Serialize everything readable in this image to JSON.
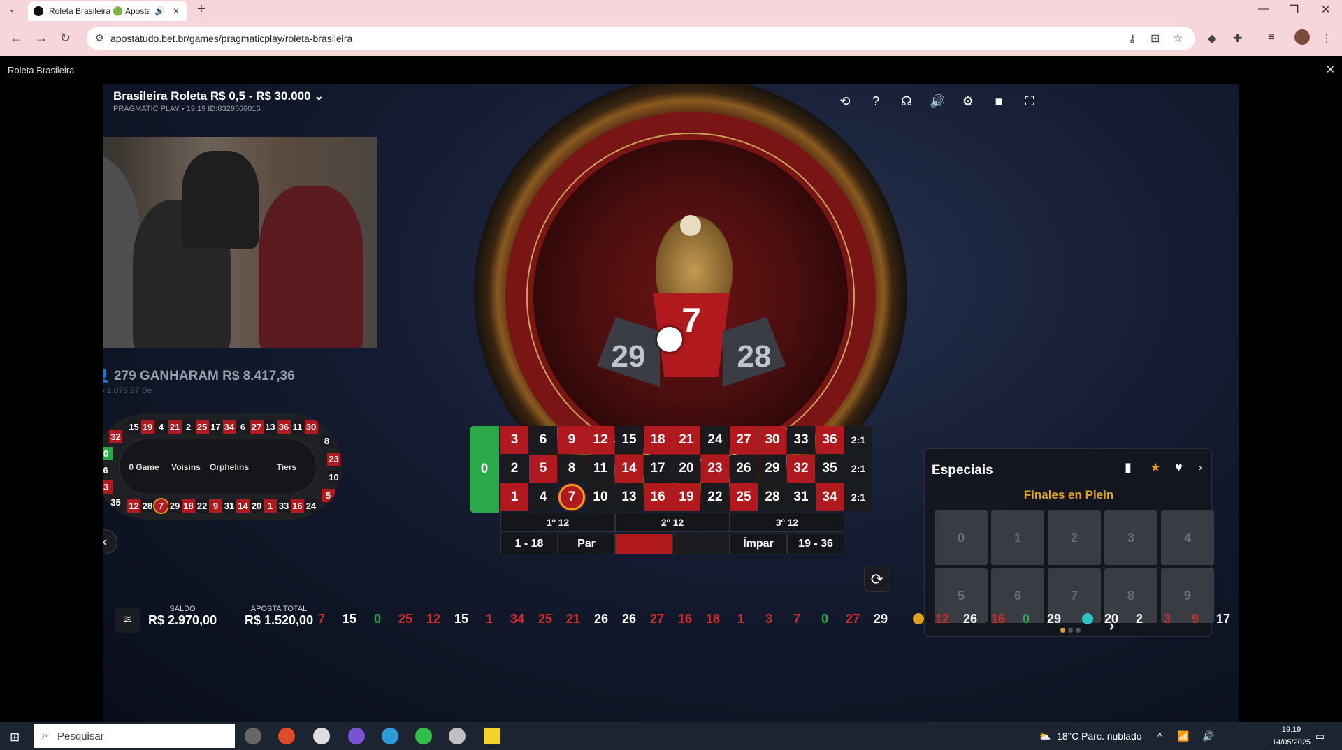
{
  "browser": {
    "tab_title": "Roleta Brasileira 🟢 Aposta",
    "tab_close": "✕",
    "new_tab": "+",
    "url": "apostatudo.bet.br/games/pragmaticplay/roleta-brasileira",
    "window_controls": [
      "—",
      "❐",
      "✕"
    ]
  },
  "frame": {
    "title": "Roleta Brasileira",
    "close": "✕"
  },
  "game": {
    "title": "Brasileira Roleta R$ 0,5 - R$ 30.000",
    "subtitle": "PRAGMATIC PLAY • 19:19 ID:8329566016",
    "result": {
      "number": "7",
      "left_neighbor": "29",
      "right_neighbor": "28"
    },
    "toolbar_icons": [
      "history-icon",
      "help-icon",
      "support-icon",
      "sound-icon",
      "settings-icon",
      "video-icon",
      "fullscreen-icon"
    ],
    "winners": "279 GANHARAM R$ 8.417,36",
    "winners_sub": "R$ 1.079,97 Be"
  },
  "racetrack": {
    "sections": [
      "0 Game",
      "Voisins",
      "Orphelins",
      "Tiers"
    ],
    "top_row": [
      "15",
      "19",
      "4",
      "21",
      "2",
      "25",
      "17",
      "34",
      "6",
      "27",
      "13",
      "36",
      "11",
      "30"
    ],
    "bottom_row": [
      "12",
      "28",
      "7",
      "29",
      "18",
      "22",
      "9",
      "31",
      "14",
      "20",
      "1",
      "33",
      "16",
      "24"
    ],
    "left_arc": [
      "32",
      "0",
      "26",
      "3",
      "35"
    ],
    "right_arc": [
      "8",
      "23",
      "10",
      "5"
    ]
  },
  "table": {
    "zero": "0",
    "rows": [
      [
        "3",
        "6",
        "9",
        "12",
        "15",
        "18",
        "21",
        "24",
        "27",
        "30",
        "33",
        "36"
      ],
      [
        "2",
        "5",
        "8",
        "11",
        "14",
        "17",
        "20",
        "23",
        "26",
        "29",
        "32",
        "35"
      ],
      [
        "1",
        "4",
        "7",
        "10",
        "13",
        "16",
        "19",
        "22",
        "25",
        "28",
        "31",
        "34"
      ]
    ],
    "row_colors": [
      [
        "red",
        "black",
        "red",
        "red",
        "black",
        "red",
        "red",
        "black",
        "red",
        "red",
        "black",
        "red"
      ],
      [
        "black",
        "red",
        "black",
        "black",
        "red",
        "black",
        "black",
        "red",
        "black",
        "black",
        "red",
        "black"
      ],
      [
        "red",
        "black",
        "red",
        "black",
        "black",
        "red",
        "red",
        "black",
        "red",
        "black",
        "black",
        "red"
      ]
    ],
    "column_bets": [
      "2:1",
      "2:1",
      "2:1"
    ],
    "dozens": [
      "1º 12",
      "2º 12",
      "3º 12"
    ],
    "even_bets": [
      "1 - 18",
      "Par",
      "",
      "",
      "Ímpar",
      "19 - 36"
    ],
    "winning_number": "7"
  },
  "specials": {
    "title": "Especiais",
    "subtitle": "Finales en Plein",
    "buttons": [
      "0",
      "1",
      "2",
      "3",
      "4",
      "5",
      "6",
      "7",
      "8",
      "9"
    ]
  },
  "footer": {
    "saldo_label": "SALDO",
    "saldo_value": "R$ 2.970,00",
    "aposta_label": "APOSTA TOTAL",
    "aposta_value": "R$ 1.520,00",
    "history": [
      {
        "n": "7",
        "c": "red"
      },
      {
        "n": "15",
        "c": "black"
      },
      {
        "n": "0",
        "c": "green"
      },
      {
        "n": "25",
        "c": "red"
      },
      {
        "n": "12",
        "c": "red"
      },
      {
        "n": "15",
        "c": "black"
      },
      {
        "n": "1",
        "c": "red"
      },
      {
        "n": "34",
        "c": "red"
      },
      {
        "n": "25",
        "c": "red"
      },
      {
        "n": "21",
        "c": "red"
      },
      {
        "n": "26",
        "c": "black"
      },
      {
        "n": "26",
        "c": "black"
      },
      {
        "n": "27",
        "c": "red"
      },
      {
        "n": "16",
        "c": "red"
      },
      {
        "n": "18",
        "c": "red"
      },
      {
        "n": "1",
        "c": "red"
      },
      {
        "n": "3",
        "c": "red"
      },
      {
        "n": "7",
        "c": "red"
      },
      {
        "n": "0",
        "c": "green"
      },
      {
        "n": "27",
        "c": "red"
      },
      {
        "n": "29",
        "c": "black"
      }
    ],
    "hot": [
      {
        "n": "12",
        "c": "red"
      },
      {
        "n": "26",
        "c": "black"
      },
      {
        "n": "16",
        "c": "red"
      },
      {
        "n": "0",
        "c": "green"
      },
      {
        "n": "29",
        "c": "black"
      }
    ],
    "cold": [
      {
        "n": "20",
        "c": "black"
      },
      {
        "n": "2",
        "c": "black"
      },
      {
        "n": "3",
        "c": "red"
      },
      {
        "n": "9",
        "c": "red"
      },
      {
        "n": "17",
        "c": "black"
      }
    ]
  },
  "taskbar": {
    "search_placeholder": "Pesquisar",
    "weather": "18°C  Parc. nublado",
    "time": "19:19",
    "date": "14/05/2025"
  }
}
